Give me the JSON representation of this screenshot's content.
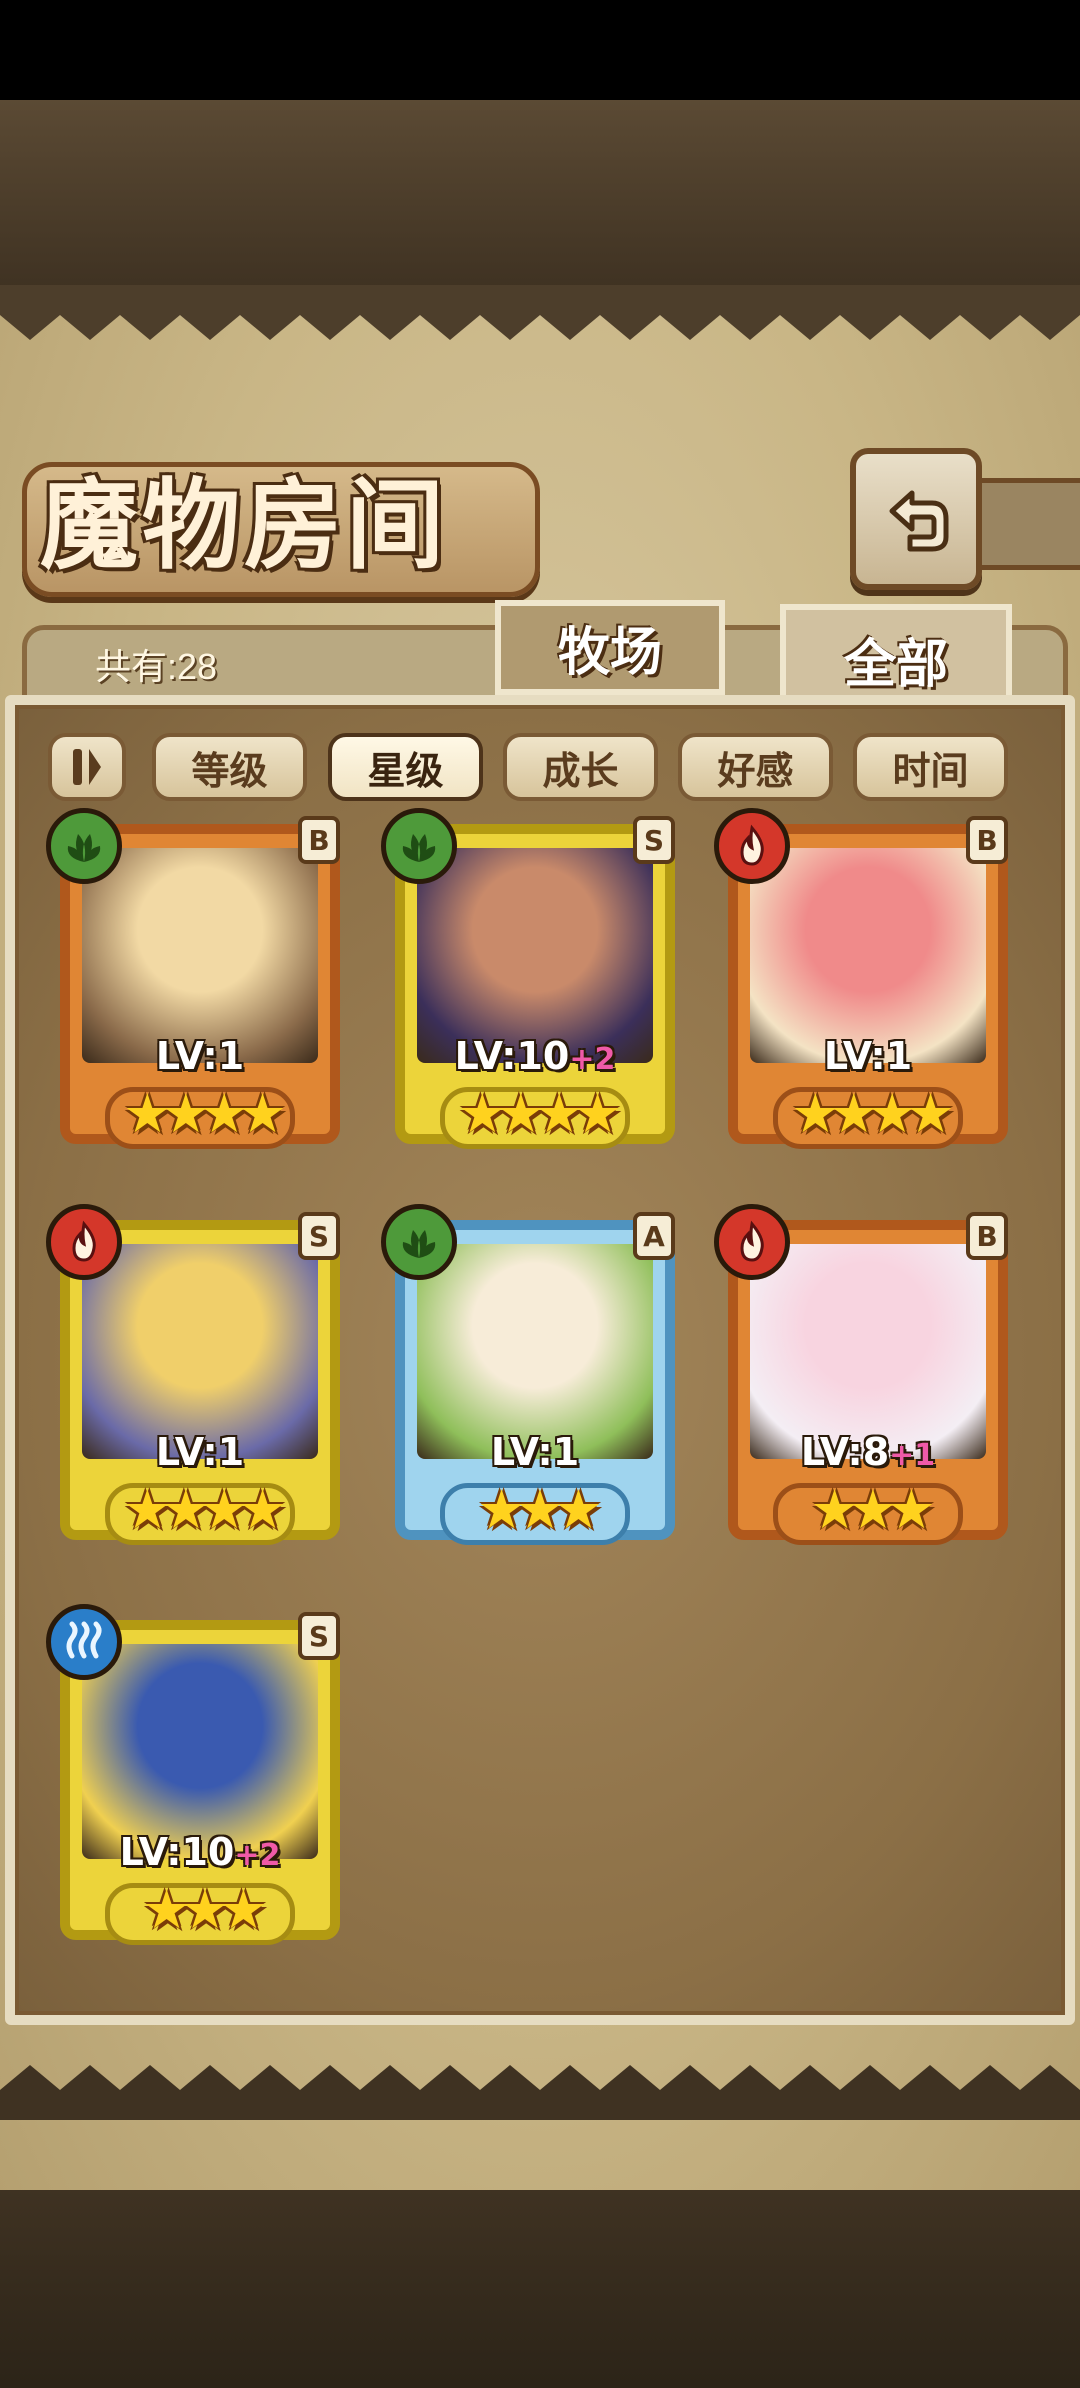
{
  "screen": {
    "title": "魔物房间",
    "total_label": "共有:28",
    "tabs": [
      {
        "label": "牧场",
        "active": false
      },
      {
        "label": "全部",
        "active": true
      }
    ],
    "sort_buttons": [
      {
        "label": "等级",
        "active": false
      },
      {
        "label": "星级",
        "active": true
      },
      {
        "label": "成长",
        "active": false
      },
      {
        "label": "好感",
        "active": false
      },
      {
        "label": "时间",
        "active": false
      }
    ]
  },
  "monsters": [
    {
      "rank": "B",
      "element": "grass",
      "level": "LV:1",
      "bonus": "",
      "stars": "★★★★",
      "portrait": [
        "#f2d9a4",
        "#8a6a4a"
      ]
    },
    {
      "rank": "S",
      "element": "grass",
      "level": "LV:10",
      "bonus": "+2",
      "stars": "★★★★",
      "portrait": [
        "#c98a6a",
        "#3b2f5a"
      ]
    },
    {
      "rank": "B",
      "element": "fire",
      "level": "LV:1",
      "bonus": "",
      "stars": "★★★★",
      "portrait": [
        "#f08a8a",
        "#f4e3c4"
      ]
    },
    {
      "rank": "S",
      "element": "fire",
      "level": "LV:1",
      "bonus": "",
      "stars": "★★★★",
      "portrait": [
        "#f0cf6a",
        "#6a6aa8"
      ]
    },
    {
      "rank": "A",
      "element": "grass",
      "level": "LV:1",
      "bonus": "",
      "stars": "★★★",
      "portrait": [
        "#f7ecd8",
        "#8fbf5a"
      ]
    },
    {
      "rank": "B",
      "element": "fire",
      "level": "LV:8",
      "bonus": "+1",
      "stars": "★★★",
      "portrait": [
        "#f8d4e0",
        "#f4eef4"
      ]
    },
    {
      "rank": "S",
      "element": "water",
      "level": "LV:10",
      "bonus": "+2",
      "stars": "★★★",
      "portrait": [
        "#3a5ab0",
        "#f0d050"
      ]
    }
  ]
}
